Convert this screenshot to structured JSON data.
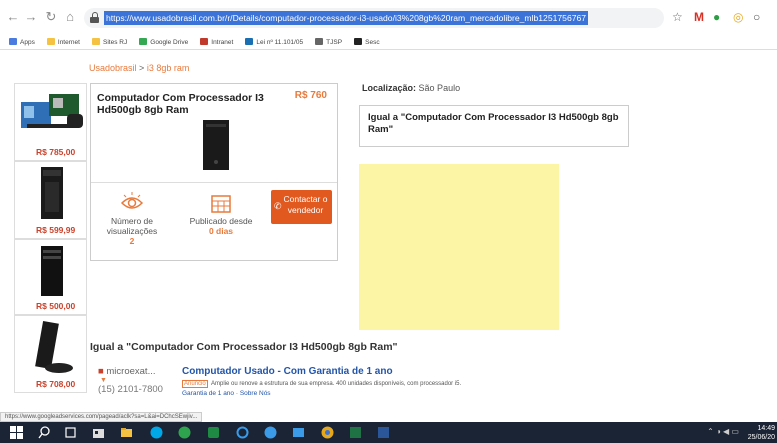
{
  "browser": {
    "url": "https://www.usadobrasil.com.br/r/Details/computador-processador-i3-usado/i3%208gb%20ram_mercadolibre_mlb1251756767",
    "bookmarks": [
      "Apps",
      "Internet",
      "Sites RJ",
      "Google Drive",
      "Intranet",
      "Lei nº 11.101/05",
      "TJSP",
      "Sesc"
    ]
  },
  "page": {
    "breadcrumb": {
      "site": "Usadobrasil",
      "separator": ">",
      "current": "i3 8gb ram"
    },
    "thumbnails": [
      {
        "price": "R$ 785,00"
      },
      {
        "price": "R$ 599,99"
      },
      {
        "price": "R$ 500,00"
      },
      {
        "price": "R$ 708,00"
      }
    ],
    "product": {
      "title": "Computador Com Processador I3 Hd500gb 8gb Ram",
      "price": "R$ 760",
      "views_label": "Número de visualizações",
      "views_value": "2",
      "published_label": "Publicado desde",
      "published_value": "0 dias",
      "contact_label": "Contactar o vendedor"
    },
    "location": {
      "label": "Localização:",
      "value": "São Paulo"
    },
    "similar_box": "Igual a \"Computador Com Processador I3 Hd500gb 8gb Ram\"",
    "section_title": "Igual a \"Computador Com Processador I3 Hd500gb 8gb Ram\"",
    "result": {
      "store": "microexat...",
      "phone": "(15) 2101-7800",
      "title": "Computador Usado - Com Garantia de 1 ano",
      "badge": "Anúncio",
      "description": "Amplie ou renove a estrutura de sua empresa. 400 unidades disponíveis, com processador i5.",
      "link1": "Garantia de 1 ano",
      "link_sep": "·",
      "link2": "Sobre Nós"
    }
  },
  "statusbar": "https://www.googleadservices.com/pagead/aclk?sa=L&ai=DChcSEwjiv...",
  "taskbar": {
    "time": "14:49",
    "date": "25/06/20"
  },
  "colors": {
    "accent": "#e87a3c",
    "contact_button": "#e2591f",
    "link": "#2255aa",
    "ad": "#fdf5a6",
    "taskbar": "#1b2434"
  }
}
